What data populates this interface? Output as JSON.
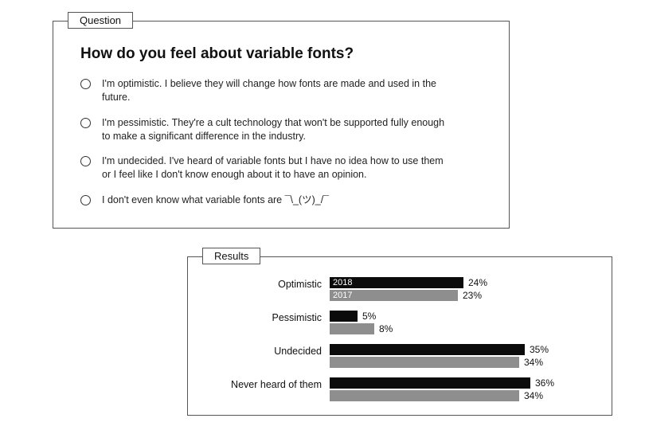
{
  "question": {
    "tab": "Question",
    "title": "How do you feel about variable fonts?",
    "options": [
      "I'm optimistic. I believe they will change how fonts are made and used in the future.",
      "I'm pessimistic. They're a cult technology that won't be supported fully enough to make a significant difference in the industry.",
      "I'm undecided. I've heard of variable fonts but I have no idea how to use them or I feel like I don't know enough about it to have an opinion.",
      "I don't even know what variable fonts are ¯\\_(ツ)_/¯"
    ]
  },
  "results": {
    "tab": "Results",
    "legend": {
      "primary": "2018",
      "secondary": "2017"
    },
    "rows": [
      {
        "label": "Optimistic",
        "y2018": "24%",
        "y2017": "23%"
      },
      {
        "label": "Pessimistic",
        "y2018": "5%",
        "y2017": "8%"
      },
      {
        "label": "Undecided",
        "y2018": "35%",
        "y2017": "34%"
      },
      {
        "label": "Never heard of them",
        "y2018": "36%",
        "y2017": "34%"
      }
    ]
  },
  "chart_data": {
    "type": "bar",
    "orientation": "horizontal",
    "title": "How do you feel about variable fonts? — Results",
    "categories": [
      "Optimistic",
      "Pessimistic",
      "Undecided",
      "Never heard of them"
    ],
    "series": [
      {
        "name": "2018",
        "color": "#0b0b0b",
        "values": [
          24,
          5,
          35,
          36
        ]
      },
      {
        "name": "2017",
        "color": "#8e8e8e",
        "values": [
          23,
          8,
          34,
          34
        ]
      }
    ],
    "xlabel": "",
    "ylabel": "",
    "xlim": [
      0,
      40
    ],
    "unit": "%"
  }
}
